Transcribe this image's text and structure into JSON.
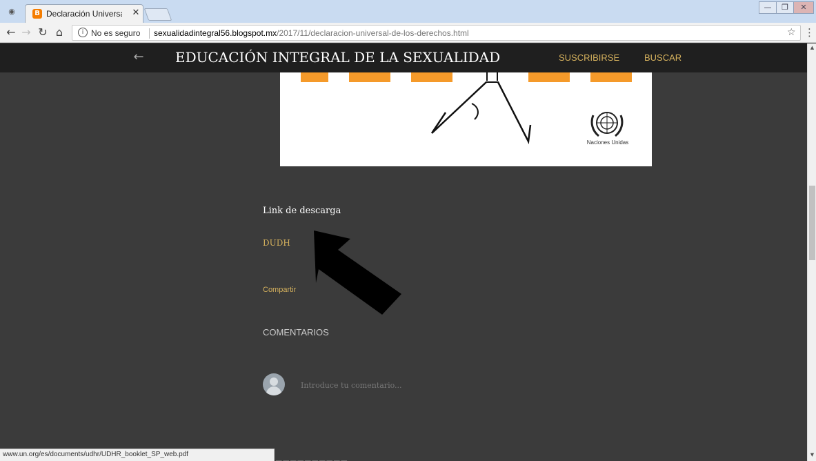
{
  "browser": {
    "tab_title": "Declaración Universal de",
    "security_label": "No es seguro",
    "url_host": "sexualidadintegral56.blogspot.mx",
    "url_path": "/2017/11/declaracion-universal-de-los-derechos.html",
    "status_url": "www.un.org/es/documents/udhr/UDHR_booklet_SP_web.pdf"
  },
  "icons": {
    "incognito": "incognito-icon",
    "favicon": "blogger-icon",
    "tab_close": "close-icon",
    "back": "back-arrow-icon",
    "forward": "forward-arrow-icon",
    "reload": "reload-icon",
    "home": "home-icon",
    "info": "info-icon",
    "star": "bookmark-star-icon",
    "menu": "menu-dots-icon"
  },
  "header": {
    "title": "EDUCACIÓN INTEGRAL DE LA SEXUALIDAD",
    "subscribe": "SUSCRIBIRSE",
    "search": "BUSCAR"
  },
  "poster": {
    "org_label": "Naciones Unidas"
  },
  "post": {
    "download_heading": "Link de descarga",
    "download_link": "DUDH",
    "share": "Compartir",
    "comments_heading": "COMENTARIOS",
    "comment_placeholder": "Introduce tu comentario..."
  },
  "colors": {
    "accent": "#d5b15d",
    "header_bg": "#1f1f1f",
    "page_bg": "#3b3b3b"
  }
}
